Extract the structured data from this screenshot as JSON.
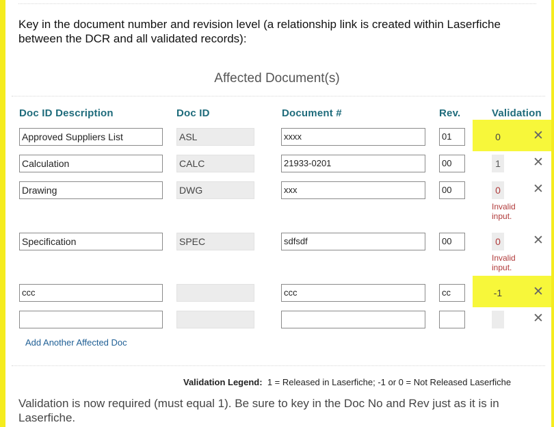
{
  "instructions": "Key in the document number and revision level (a relationship link is created within Laserfiche between the DCR and all validated records):",
  "section_title": "Affected Document(s)",
  "columns": {
    "description": "Doc ID Description",
    "doc_id": "Doc ID",
    "document_number": "Document #",
    "revision": "Rev.",
    "validation": "Validation"
  },
  "rows": [
    {
      "description": "Approved Suppliers List",
      "doc_id": "ASL",
      "document_number": "xxxx",
      "revision": "01",
      "validation": "0",
      "error": "",
      "highlighted": true
    },
    {
      "description": "Calculation",
      "doc_id": "CALC",
      "document_number": "21933-0201",
      "revision": "00",
      "validation": "1",
      "error": "",
      "highlighted": false
    },
    {
      "description": "Drawing",
      "doc_id": "DWG",
      "document_number": "xxx",
      "revision": "00",
      "validation": "0",
      "error": "Invalid input.",
      "highlighted": false
    },
    {
      "description": "Specification",
      "doc_id": "SPEC",
      "document_number": "sdfsdf",
      "revision": "00",
      "validation": "0",
      "error": "Invalid input.",
      "highlighted": false
    },
    {
      "description": "ccc",
      "doc_id": "",
      "document_number": "ccc",
      "revision": "cc",
      "validation": "-1",
      "error": "",
      "highlighted": true
    },
    {
      "description": "",
      "doc_id": "",
      "document_number": "",
      "revision": "",
      "validation": "",
      "error": "",
      "highlighted": false
    }
  ],
  "error_lines": {
    "line1": "Invalid",
    "line2": "input."
  },
  "remove_icon": "close-icon",
  "remove_glyph": "✕",
  "add_link": "Add Another Affected Doc",
  "legend": {
    "label": "Validation Legend:",
    "text": "1 = Released in Laserfiche; -1 or 0 = Not Released Laserfiche"
  },
  "footer_note": "Validation is now required (must equal 1). Be sure to key in the Doc No and Rev just as it is in Laserfiche.",
  "colors": {
    "edge_yellow": "#f5ec1e",
    "highlight_yellow": "#f7f73a",
    "header_teal": "#1e6b7b",
    "error_red": "#b03a3a",
    "link_blue": "#1f5f95"
  }
}
